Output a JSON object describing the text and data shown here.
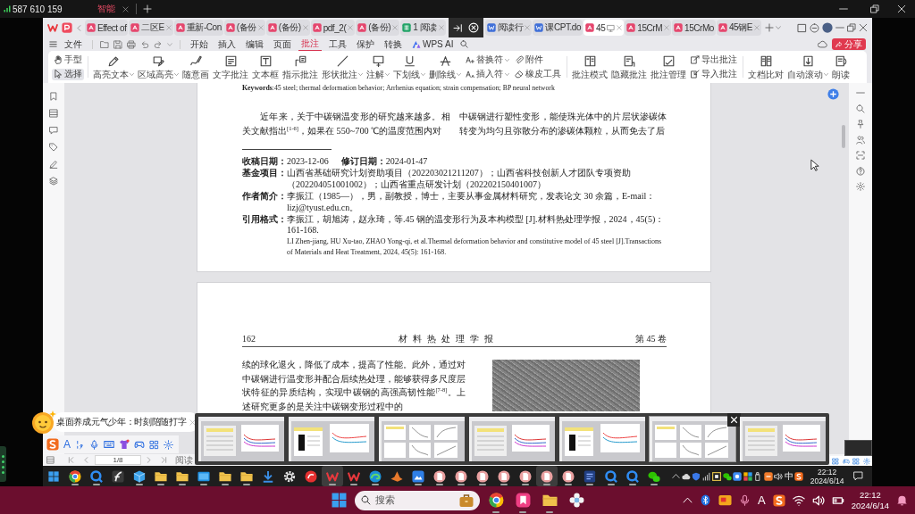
{
  "session_bar": {
    "id": "587 610 159",
    "tab": "智能"
  },
  "app": {
    "tabs": [
      {
        "label": "Effect of",
        "kind": "pdf",
        "selected": false,
        "close": false
      },
      {
        "label": "二区E",
        "kind": "pdf",
        "selected": false,
        "close": true
      },
      {
        "label": "重新-Con",
        "kind": "pdf",
        "selected": false,
        "close": false
      },
      {
        "label": "(备份",
        "kind": "pdf",
        "selected": false,
        "close": true
      },
      {
        "label": "(备份)",
        "kind": "pdf",
        "selected": false,
        "close": true
      },
      {
        "label": "pdf_2(",
        "kind": "pdf",
        "selected": false,
        "close": true
      },
      {
        "label": "(备份)",
        "kind": "pdf",
        "selected": false,
        "close": true
      },
      {
        "label": "1 阅读",
        "kind": "sheet",
        "selected": false,
        "close": true
      },
      {
        "label": "阅读行",
        "kind": "word",
        "selected": false,
        "close": true
      },
      {
        "label": "课CPT.do",
        "kind": "word",
        "selected": false,
        "close": false
      },
      {
        "label": "45",
        "kind": "pdf",
        "selected": true,
        "close": true
      },
      {
        "label": "15CrM",
        "kind": "pdf",
        "selected": false,
        "close": true
      },
      {
        "label": "15CrMo",
        "kind": "pdf",
        "selected": false,
        "close": false
      },
      {
        "label": "45钢E",
        "kind": "pdf",
        "selected": false,
        "close": true
      }
    ],
    "menu": {
      "file": "文件",
      "items": [
        {
          "label": "开始",
          "selected": false
        },
        {
          "label": "插入",
          "selected": false
        },
        {
          "label": "编辑",
          "selected": false
        },
        {
          "label": "页面",
          "selected": false
        },
        {
          "label": "批注",
          "selected": true
        },
        {
          "label": "工具",
          "selected": false
        },
        {
          "label": "保护",
          "selected": false
        },
        {
          "label": "转换",
          "selected": false
        }
      ],
      "ai": "WPS AI",
      "share": "分享"
    },
    "tools": [
      {
        "kind": "stack",
        "items": [
          {
            "label": "手型",
            "selected": false
          },
          {
            "label": "选择",
            "selected": true
          }
        ]
      },
      {
        "kind": "button",
        "label": "高亮文本",
        "dropdown": true
      },
      {
        "kind": "button",
        "label": "区域高亮",
        "dropdown": true
      },
      {
        "kind": "button",
        "label": "随意画",
        "dropdown": false
      },
      {
        "kind": "button",
        "label": "文字批注",
        "dropdown": false
      },
      {
        "kind": "button",
        "label": "文本框",
        "dropdown": false
      },
      {
        "kind": "button",
        "label": "指示批注",
        "dropdown": false
      },
      {
        "kind": "button",
        "label": "形状批注",
        "dropdown": true
      },
      {
        "kind": "button",
        "label": "注解",
        "dropdown": true
      },
      {
        "kind": "button",
        "label": "下划线",
        "dropdown": true
      },
      {
        "kind": "button",
        "label": "删除线",
        "dropdown": true
      },
      {
        "kind": "stack",
        "items": [
          {
            "label": "替换符",
            "dropdown": true
          },
          {
            "label": "插入符",
            "dropdown": true
          }
        ]
      },
      {
        "kind": "stack",
        "items": [
          {
            "label": "附件",
            "dropdown": false
          },
          {
            "label": "橡皮工具",
            "dropdown": false
          }
        ]
      },
      {
        "kind": "button",
        "label": "批注模式",
        "dropdown": false
      },
      {
        "kind": "button",
        "label": "隐藏批注",
        "dropdown": false
      },
      {
        "kind": "button",
        "label": "批注管理",
        "dropdown": false
      },
      {
        "kind": "stack",
        "items": [
          {
            "label": "导出批注",
            "dropdown": false
          },
          {
            "label": "导入批注",
            "dropdown": false
          }
        ]
      },
      {
        "kind": "button",
        "label": "文档比对",
        "dropdown": false
      },
      {
        "kind": "button",
        "label": "自动滚动",
        "dropdown": true
      },
      {
        "kind": "button",
        "label": "朗读",
        "dropdown": false
      }
    ]
  },
  "document": {
    "page1": {
      "keywords": "**Keywords**:45 steel; thermal deformation behavior; Arrhenius equation; strain compensation; BP neural network",
      "column_left": "近年来，关于中碳钢温变形的研究越来越多。相关文献指出$^{[1-6]}$，如果在 550~700 ℃的温度范围内对",
      "column_right": "中碳钢进行塑性变形，能使珠光体中的片层状渗碳体转变为均匀且弥散分布的渗碳体颗粒，从而免去了后",
      "footnotes": [
        {
          "label": "收稿日期：",
          "text": "2023-12-06",
          "label2": "修订日期：",
          "text2": "2024-01-47"
        },
        {
          "label": "基金项目：",
          "text": "山西省基础研究计划资助项目（202203021211207）；山西省科技创新人才团队专项资助（202204051001002）；山西省重点研发计划（202202150401007）"
        },
        {
          "label": "作者简介：",
          "text": "李振江（1985—），男，副教授，博士，主要从事金属材料研究，发表论文 30 余篇，E-mail：lizj@tyust.edu.cn。"
        },
        {
          "label": "引用格式：",
          "text": "李振江，胡旭涛，赵永琦，等.45 钢的温变形行为及本构模型 [J].材料热处理学报，2024，45(5)：161-168.",
          "text_en": "LI Zhen-jiang, HU Xu-tao, ZHAO Yong-qi, et al.Thermal deformation behavior and constitutive model of 45 steel [J].Transactions of Materials and Heat Treatment, 2024, 45(5): 161-168."
        }
      ]
    },
    "page2": {
      "running_head": {
        "page_number": "162",
        "journal": "材 料 热 处 理 学 报",
        "volume": "第 45 卷"
      },
      "column_left": "续的球化退火，降低了成本，提高了性能。此外，通过对中碳钢进行温变形并配合后续热处理，能够获得多尺度层状特征的异质结构，实现中碳钢的高强高韧性能$^{[7-8]}$。上述研究更多的是关注中碳钢变形过程中的"
    }
  },
  "status_bar": {
    "page_field": "1/8",
    "view_label": "阅读"
  },
  "ime_popup": {
    "message": "桌面养成元气少年：时刻陪随打字"
  },
  "ime_toolbar": {
    "mode": "A"
  },
  "window_previews": [
    {
      "hovered": false
    },
    {
      "hovered": false
    },
    {
      "hovered": false
    },
    {
      "hovered": false
    },
    {
      "hovered": false
    },
    {
      "hovered": true
    },
    {
      "hovered": false
    }
  ],
  "inner_taskbar": {
    "apps": [
      {
        "kind": "chrome",
        "running": true,
        "active": false
      },
      {
        "kind": "qbrowser",
        "running": true,
        "active": false
      },
      {
        "kind": "fapp",
        "running": false,
        "active": false
      },
      {
        "kind": "cube",
        "running": true,
        "active": false
      },
      {
        "kind": "folder",
        "running": true,
        "active": false
      },
      {
        "kind": "folder",
        "running": true,
        "active": false
      },
      {
        "kind": "monitor",
        "running": true,
        "active": false
      },
      {
        "kind": "folder",
        "running": true,
        "active": false
      },
      {
        "kind": "folder",
        "running": true,
        "active": false
      },
      {
        "kind": "download",
        "running": false,
        "active": false
      },
      {
        "kind": "gear",
        "running": false,
        "active": false
      },
      {
        "kind": "redapp",
        "running": false,
        "active": false
      },
      {
        "kind": "wps",
        "running": true,
        "active": true
      },
      {
        "kind": "wps",
        "running": true,
        "active": false
      },
      {
        "kind": "edge",
        "running": true,
        "active": false
      },
      {
        "kind": "matlab",
        "running": false,
        "active": false
      },
      {
        "kind": "photos",
        "running": true,
        "active": false
      },
      {
        "kind": "pdf",
        "running": true,
        "active": false
      },
      {
        "kind": "pdf",
        "running": true,
        "active": false
      },
      {
        "kind": "pdf",
        "running": true,
        "active": false
      },
      {
        "kind": "pdf",
        "running": true,
        "active": false
      },
      {
        "kind": "pdf",
        "running": true,
        "active": false
      },
      {
        "kind": "pdf",
        "running": true,
        "active": true
      },
      {
        "kind": "pdf",
        "running": true,
        "active": false
      },
      {
        "kind": "darkdoc",
        "running": true,
        "active": false
      },
      {
        "kind": "qbrowser",
        "running": true,
        "active": false
      },
      {
        "kind": "qbrowser",
        "running": true,
        "active": false
      },
      {
        "kind": "wechat",
        "running": true,
        "active": false
      }
    ],
    "tray": {
      "input_mode": "中",
      "time": "22:12",
      "date": "2024/6/14"
    }
  },
  "taskbar": {
    "search": {
      "placeholder": "搜索"
    },
    "apps": [
      {
        "kind": "chrome",
        "running": true
      },
      {
        "kind": "pinkapp",
        "running": true
      },
      {
        "kind": "folder",
        "running": true
      },
      {
        "kind": "flower",
        "running": false
      }
    ],
    "tray": {
      "input_mode": "A",
      "time": "22:12",
      "date": "2024/6/14"
    }
  }
}
